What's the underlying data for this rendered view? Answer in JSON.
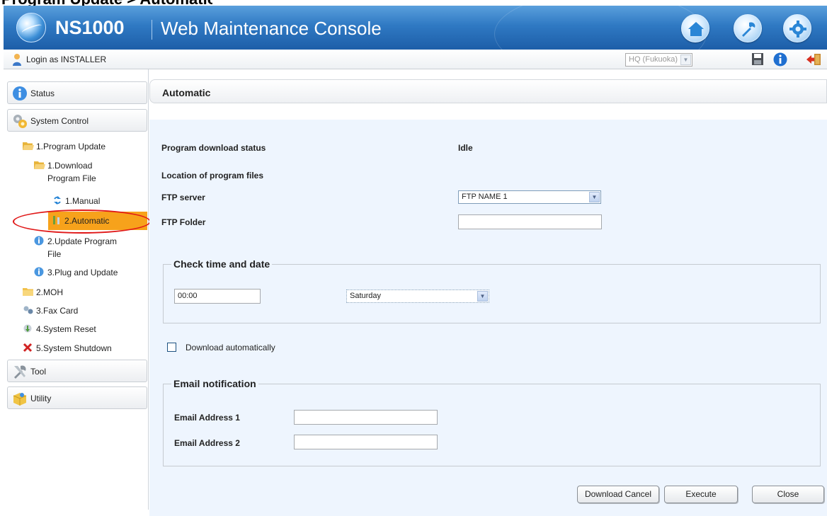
{
  "page_heading": "Program Update > Automatic",
  "app": {
    "brand": "NS1000",
    "subtitle": "Web Maintenance Console"
  },
  "top_buttons": [
    "home-icon",
    "tool-icon",
    "gear-icon"
  ],
  "login": {
    "text": "Login as INSTALLER",
    "site": "HQ (Fukuoka)"
  },
  "sidebar": {
    "sections": {
      "status": "Status",
      "system_control": "System Control",
      "tool": "Tool",
      "utility": "Utility"
    },
    "items": {
      "program_update": "1.Program Update",
      "download_program_file_1": "1.Download",
      "download_program_file_2": "Program File",
      "manual": "1.Manual",
      "automatic": "2.Automatic",
      "update_program_file_1": "2.Update Program",
      "update_program_file_2": "File",
      "plug_and_update": "3.Plug and Update",
      "moh": "2.MOH",
      "fax_card": "3.Fax Card",
      "system_reset": "4.System Reset",
      "system_shutdown": "5.System Shutdown"
    },
    "highlight_color": "#f7a21b"
  },
  "panel": {
    "title": "Automatic",
    "download_status_label": "Program download status",
    "download_status_value": "Idle",
    "location_label": "Location of program files",
    "ftp_server_label": "FTP server",
    "ftp_server_value": "FTP NAME 1",
    "ftp_folder_label": "FTP Folder",
    "ftp_folder_value": "",
    "check_group_title": "Check time and date",
    "time_value": "00:00",
    "day_value": "Saturday",
    "download_auto_label": "Download automatically",
    "download_auto_checked": false,
    "email_group_title": "Email notification",
    "email1_label": "Email Address 1",
    "email1_value": "",
    "email2_label": "Email Address 2",
    "email2_value": ""
  },
  "buttons": {
    "download_cancel": "Download Cancel",
    "execute": "Execute",
    "close": "Close"
  }
}
